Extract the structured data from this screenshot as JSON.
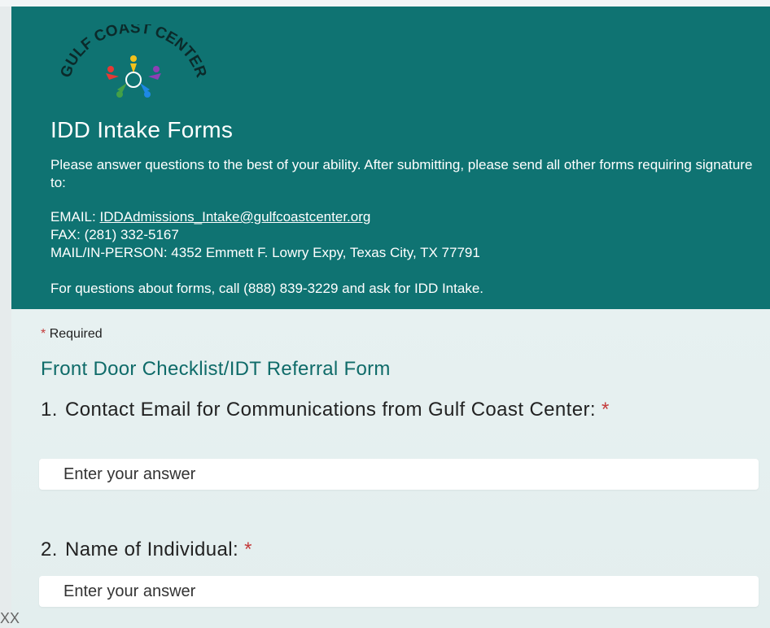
{
  "header": {
    "logo_text": "GULF COAST CENTER",
    "title": "IDD Intake Forms",
    "description": "Please answer questions to the best of your ability. After submitting, please send all other forms requiring signature to:",
    "email_label": "EMAIL: ",
    "email": "IDDAdmissions_Intake@gulfcoastcenter.org",
    "fax": "FAX: (281) 332-5167",
    "mail": "MAIL/IN-PERSON: 4352 Emmett F. Lowry Expy, Texas City, TX 77791",
    "questions_note": "For questions about forms, call (888) 839-3229 and ask for IDD Intake."
  },
  "form": {
    "required_star": "*",
    "required_label": "Required",
    "section_title": "Front Door Checklist/IDT Referral Form",
    "questions": [
      {
        "number": "1.",
        "text": "Contact Email for Communications from Gulf Coast Center:",
        "star": "*",
        "placeholder": "Enter your answer",
        "value": ""
      },
      {
        "number": "2.",
        "text": "Name of Individual:",
        "star": "*",
        "placeholder": "Enter your answer",
        "value": ""
      }
    ]
  },
  "corner_mark": "XX",
  "colors": {
    "header_bg": "#0f7372",
    "accent_teal": "#0f6b69",
    "required_red": "#c43b3b",
    "form_bg": "#e7f1f1"
  }
}
